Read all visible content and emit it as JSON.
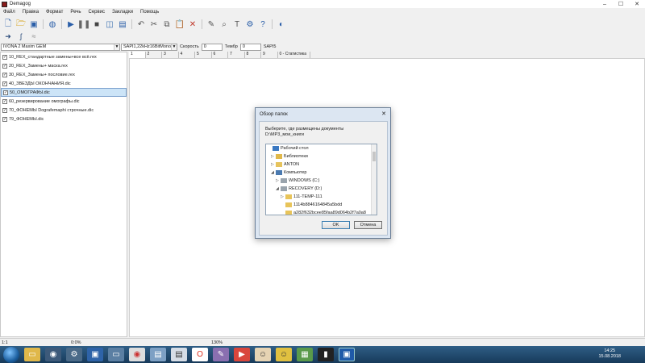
{
  "window": {
    "title": "Demagog"
  },
  "menu": [
    "Файл",
    "Правка",
    "Формат",
    "Речь",
    "Сервис",
    "Закладки",
    "Помощь"
  ],
  "toolbar": {
    "icons": [
      "new-file-icon",
      "open-folder-icon",
      "save-icon",
      "globe-icon",
      "play-icon",
      "pause-icon",
      "stop-icon",
      "record-icon",
      "book-icon",
      "undo-icon",
      "cut-icon",
      "copy-icon",
      "paste-icon",
      "delete-icon",
      "edit-icon",
      "find-icon",
      "text-icon",
      "settings-icon",
      "help-icon",
      "internet-icon"
    ],
    "row2_icons": [
      "arrow-icon",
      "function-icon",
      "wave-icon"
    ]
  },
  "settings": {
    "voice": "IVONA 2 Maxim GEM",
    "format": "SAPI1,22kHz16BitMono...",
    "speed_label": "Скорость",
    "speed_value": "0",
    "pitch_label": "Тембр",
    "pitch_value": "0",
    "engine": "SAPI5"
  },
  "file_list": [
    {
      "name": "10_REX_стандартные замены+все всё.rex",
      "checked": true,
      "selected": false
    },
    {
      "name": "20_REX_Замены+ маска.rex",
      "checked": true,
      "selected": false
    },
    {
      "name": "30_REX_Замены+ пословие.rex",
      "checked": true,
      "selected": false
    },
    {
      "name": "40_ЗВЕЗДЫ ОКОНЧАНИЯ.dic",
      "checked": true,
      "selected": false
    },
    {
      "name": "50_ОМОГРАФЫ.dic",
      "checked": true,
      "selected": true
    },
    {
      "name": "60_резервирование омографы.dic",
      "checked": true,
      "selected": false
    },
    {
      "name": "70_ФОНЕМЫ Dografemaphi строчные.dic",
      "checked": true,
      "selected": false
    },
    {
      "name": "79_ФОНЕМЫ.dic",
      "checked": true,
      "selected": false
    }
  ],
  "tabs": [
    "1",
    "2",
    "3",
    "4",
    "5",
    "6",
    "7",
    "8",
    "9",
    "0 - Статистика"
  ],
  "status": {
    "position": "1:1",
    "progress": "0:0%",
    "zoom": "130%"
  },
  "dialog": {
    "title": "Обзор папок",
    "message": "Выберите, где размещены документы D:\\MP3_мои_книги",
    "tree": [
      {
        "label": "Рабочий стол",
        "indent": 0,
        "arrow": "",
        "icon": "desktop-icon"
      },
      {
        "label": "Библиотеки",
        "indent": 1,
        "arrow": "▷",
        "icon": "library-icon"
      },
      {
        "label": "ANTON",
        "indent": 1,
        "arrow": "▷",
        "icon": "user-folder-icon"
      },
      {
        "label": "Компьютер",
        "indent": 1,
        "arrow": "◢",
        "icon": "computer-icon"
      },
      {
        "label": "WINDOWS (C:)",
        "indent": 2,
        "arrow": "▷",
        "icon": "drive-icon"
      },
      {
        "label": "RECOVERY (D:)",
        "indent": 2,
        "arrow": "◢",
        "icon": "drive-icon"
      },
      {
        "label": "111-TEMP-111",
        "indent": 3,
        "arrow": "▷",
        "icon": "folder-icon"
      },
      {
        "label": "1114b8846164845a5bdd",
        "indent": 3,
        "arrow": "",
        "icon": "folder-icon"
      },
      {
        "label": "a282f632bcee85faa89d064b2f7a0a8",
        "indent": 3,
        "arrow": "",
        "icon": "folder-icon"
      }
    ],
    "ok_label": "OK",
    "cancel_label": "Отмена"
  },
  "taskbar": {
    "apps": [
      "explorer-icon",
      "lock-app-icon",
      "utility-icon",
      "save-app-icon",
      "monitor-app-icon",
      "chrome-icon",
      "document-app-icon",
      "document-app-icon-2",
      "opera-icon",
      "paint-app-icon",
      "media-app-icon",
      "image-app-icon",
      "smiley-app-icon",
      "chart-app-icon",
      "terminal-app-icon",
      "demagog-app-icon"
    ],
    "time": "14:25",
    "date": "15.08.2018"
  }
}
